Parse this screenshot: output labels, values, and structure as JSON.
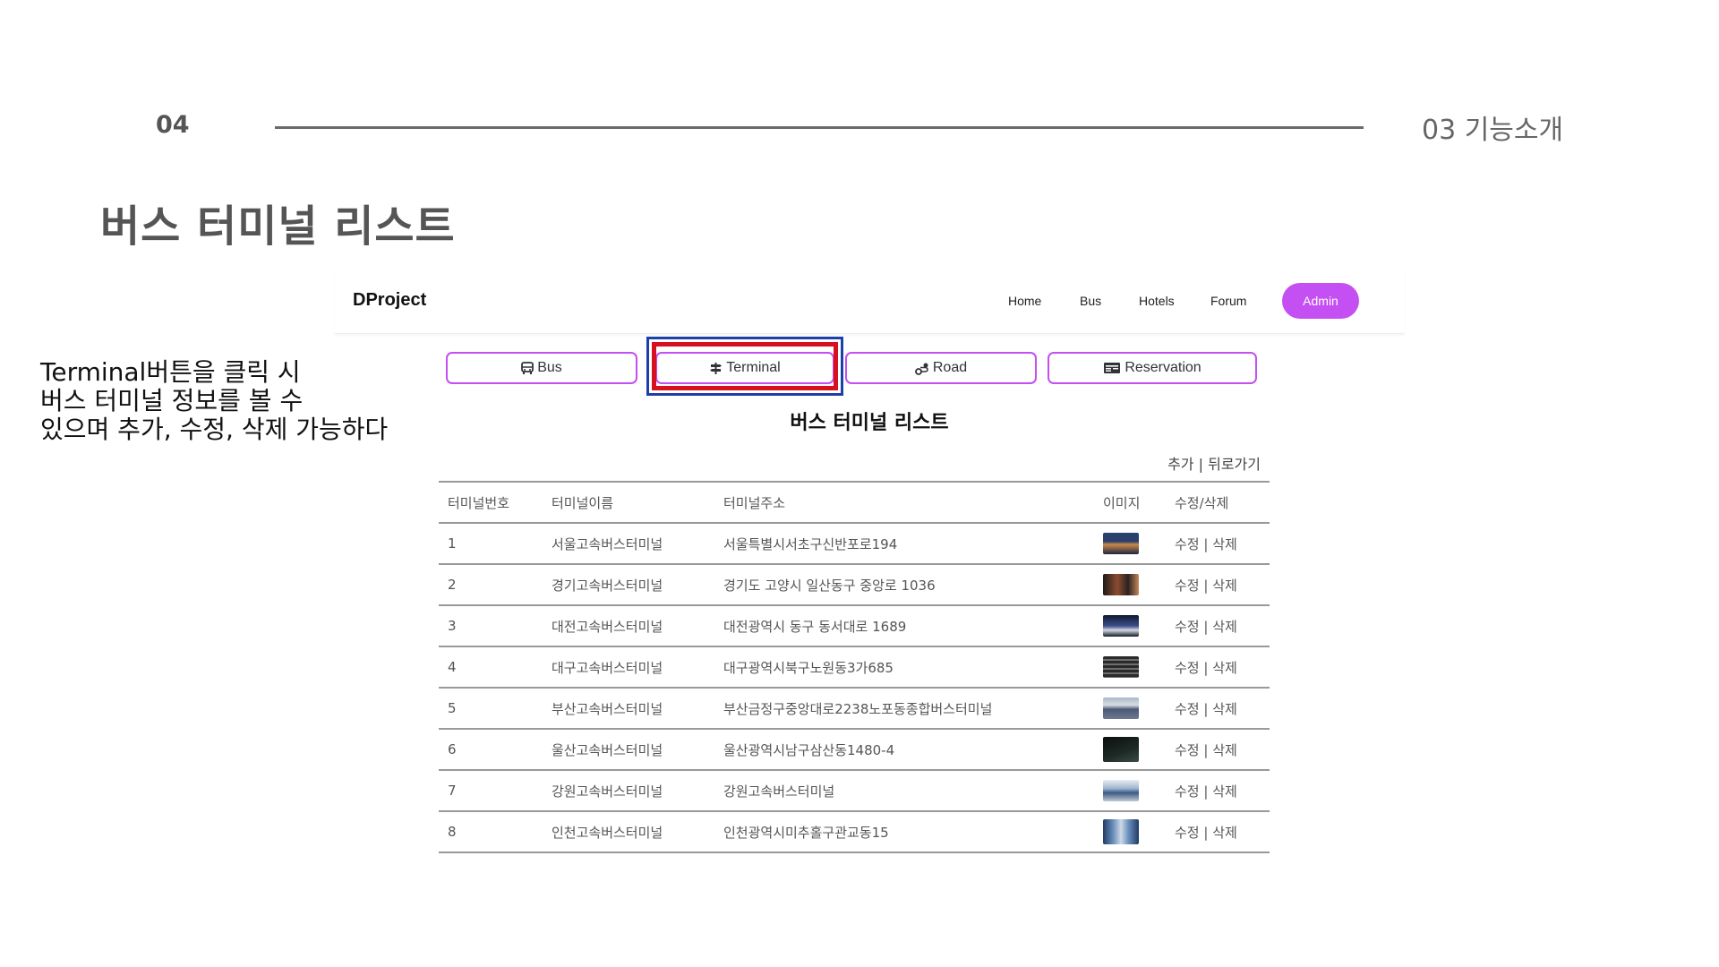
{
  "slide": {
    "number": "04",
    "section": "03 기능소개",
    "title": "버스 터미널 리스트",
    "description": [
      "Terminal버튼을 클릭 시",
      "버스 터미널 정보를 볼 수",
      "있으며 추가, 수정, 삭제 가능하다"
    ]
  },
  "app": {
    "brand": "DProject",
    "nav": {
      "home": "Home",
      "bus": "Bus",
      "hotels": "Hotels",
      "forum": "Forum",
      "admin": "Admin"
    },
    "accent_color": "#c44ff2",
    "tabs": {
      "bus": {
        "label": "Bus",
        "icon": "bus-icon"
      },
      "terminal": {
        "label": "Terminal",
        "icon": "signpost-icon"
      },
      "road": {
        "label": "Road",
        "icon": "route-icon"
      },
      "reservation": {
        "label": "Reservation",
        "icon": "ticket-icon"
      }
    },
    "highlight_colors": {
      "outer": "#1c3fa8",
      "inner": "#d6101e"
    },
    "list_title": "버스 터미널 리스트",
    "actions": {
      "add": "추가",
      "separator": "|",
      "back": "뒤로가기"
    },
    "table": {
      "headers": {
        "no": "터미널번호",
        "name": "터미널이름",
        "address": "터미널주소",
        "image": "이미지",
        "edit_delete": "수정/삭제"
      },
      "edit": "수정",
      "separator": "|",
      "delete": "삭제",
      "rows": [
        {
          "no": "1",
          "name": "서울고속버스터미널",
          "address": "서울특별시서초구신반포로194"
        },
        {
          "no": "2",
          "name": "경기고속버스터미널",
          "address": "경기도 고양시 일산동구 중앙로 1036"
        },
        {
          "no": "3",
          "name": "대전고속버스터미널",
          "address": "대전광역시 동구 동서대로 1689"
        },
        {
          "no": "4",
          "name": "대구고속버스터미널",
          "address": "대구광역시북구노원동3가685"
        },
        {
          "no": "5",
          "name": "부산고속버스터미널",
          "address": "부산금정구중앙대로2238노포동종합버스터미널"
        },
        {
          "no": "6",
          "name": "울산고속버스터미널",
          "address": "울산광역시남구삼산동1480-4"
        },
        {
          "no": "7",
          "name": "강원고속버스터미널",
          "address": "강원고속버스터미널"
        },
        {
          "no": "8",
          "name": "인천고속버스터미널",
          "address": "인천광역시미추홀구관교동15"
        }
      ]
    }
  }
}
